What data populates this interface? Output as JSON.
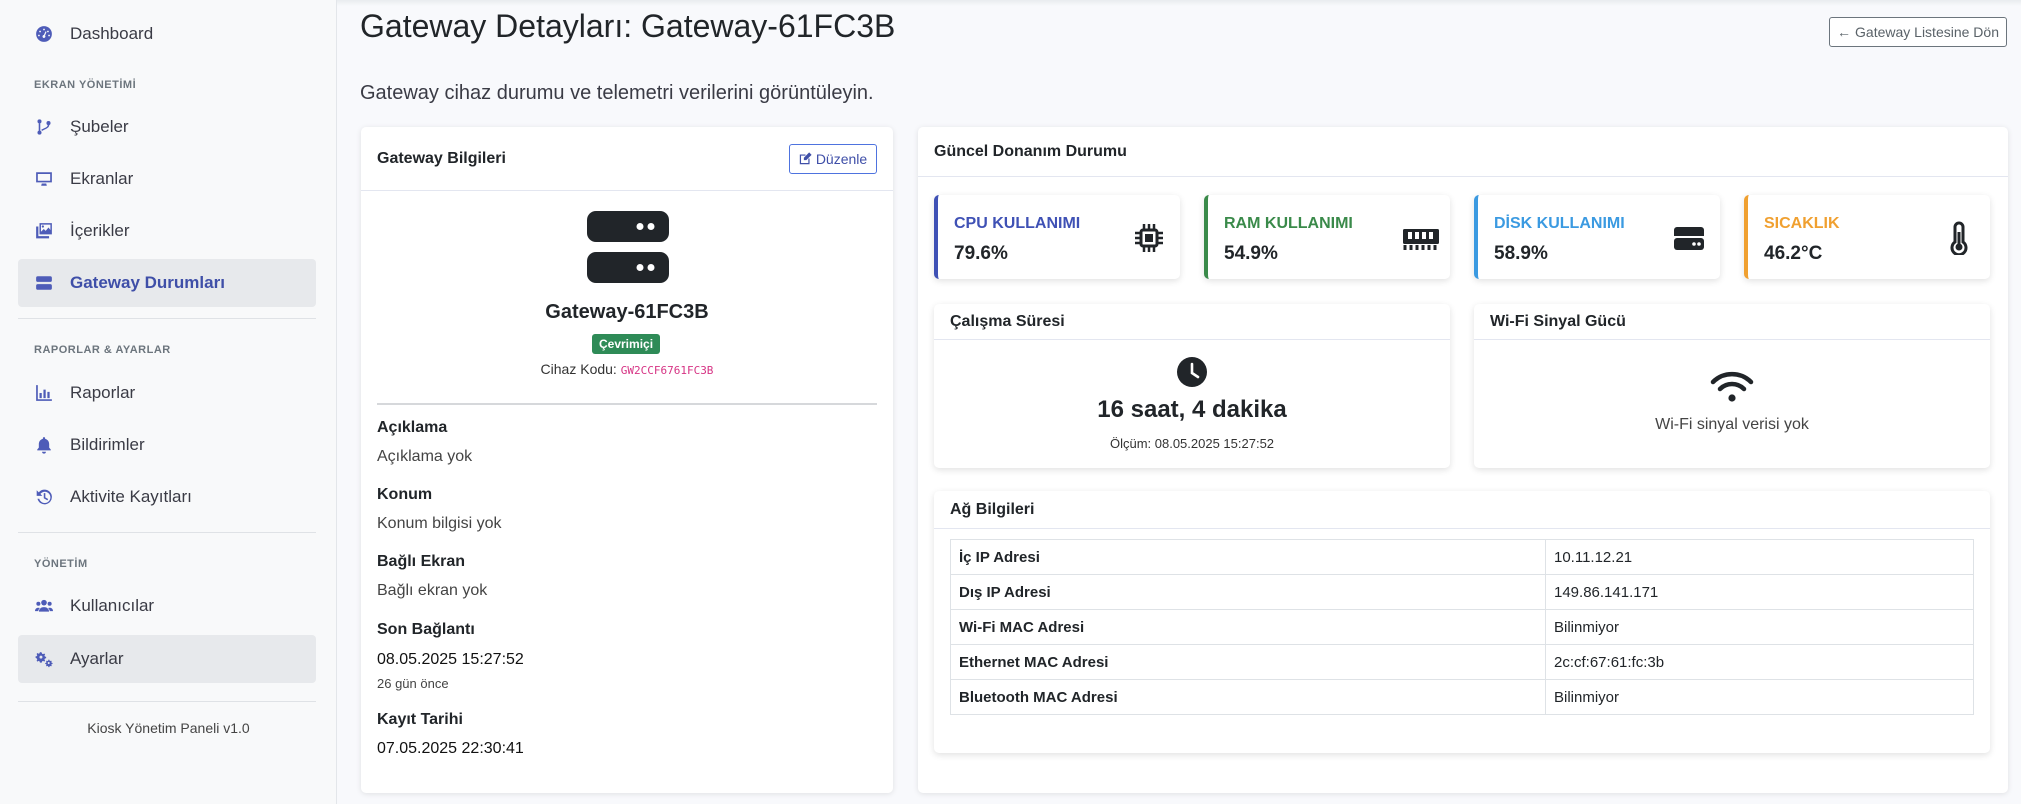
{
  "sidebar": {
    "dashboard": "Dashboard",
    "section_screen": "EKRAN YÖNETİMİ",
    "subeler": "Şubeler",
    "ekranlar": "Ekranlar",
    "icerikler": "İçerikler",
    "gateway": "Gateway Durumları",
    "section_reports": "RAPORLAR & AYARLAR",
    "raporlar": "Raporlar",
    "bildirimler": "Bildirimler",
    "aktivite": "Aktivite Kayıtları",
    "section_admin": "YÖNETİM",
    "kullanicilar": "Kullanıcılar",
    "ayarlar": "Ayarlar",
    "footer": "Kiosk Yönetim Paneli v1.0"
  },
  "header": {
    "title": "Gateway Detayları: Gateway-61FC3B",
    "back_button": "Gateway Listesine Dön",
    "subtitle": "Gateway cihaz durumu ve telemetri verilerini görüntüleyin."
  },
  "info": {
    "header": "Gateway Bilgileri",
    "edit": "Düzenle",
    "name": "Gateway-61FC3B",
    "status": "Çevrimiçi",
    "code_label": "Cihaz Kodu:",
    "code": "GW2CCF6761FC3B",
    "desc_label": "Açıklama",
    "desc_value": "Açıklama yok",
    "loc_label": "Konum",
    "loc_value": "Konum bilgisi yok",
    "screen_label": "Bağlı Ekran",
    "screen_value": "Bağlı ekran yok",
    "last_label": "Son Bağlantı",
    "last_value": "08.05.2025 15:27:52",
    "last_rel": "26 gün önce",
    "reg_label": "Kayıt Tarihi",
    "reg_value": "07.05.2025 22:30:41"
  },
  "hardware": {
    "header": "Güncel Donanım Durumu",
    "stats": [
      {
        "label": "CPU KULLANIMI",
        "value": "79.6%",
        "color": "#3f51b5",
        "icon": "cpu-icon"
      },
      {
        "label": "RAM KULLANIMI",
        "value": "54.9%",
        "color": "#3a8a4a",
        "icon": "memory-icon"
      },
      {
        "label": "DİSK KULLANIMI",
        "value": "58.9%",
        "color": "#3b9ae1",
        "icon": "hdd-icon"
      },
      {
        "label": "SICAKLIK",
        "value": "46.2°C",
        "color": "#f0a030",
        "icon": "thermometer-icon"
      }
    ],
    "uptime": {
      "header": "Çalışma Süresi",
      "value": "16 saat, 4 dakika",
      "measured": "Ölçüm: 08.05.2025 15:27:52"
    },
    "wifi": {
      "header": "Wi-Fi Sinyal Gücü",
      "value": "Wi-Fi sinyal verisi yok"
    }
  },
  "network": {
    "header": "Ağ Bilgileri",
    "rows": [
      {
        "key": "İç IP Adresi",
        "value": "10.11.12.21"
      },
      {
        "key": "Dış IP Adresi",
        "value": "149.86.141.171"
      },
      {
        "key": "Wi-Fi MAC Adresi",
        "value": "Bilinmiyor"
      },
      {
        "key": "Ethernet MAC Adresi",
        "value": "2c:cf:67:61:fc:3b"
      },
      {
        "key": "Bluetooth MAC Adresi",
        "value": "Bilinmiyor"
      }
    ]
  }
}
